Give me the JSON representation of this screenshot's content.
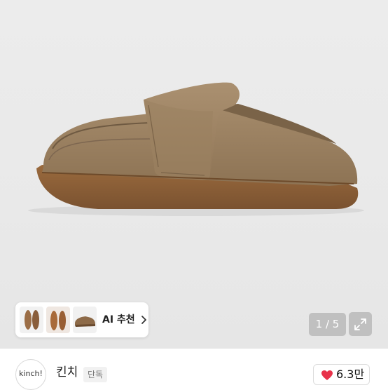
{
  "gallery": {
    "counter": "1 / 5",
    "expand_icon": "expand-icon"
  },
  "ai_recommend": {
    "label": "AI 추천",
    "thumbnails": [
      "loafer-pair-top",
      "loafer-pair-top-2",
      "loafer-side"
    ],
    "chevron_icon": "chevron-right-icon"
  },
  "shop": {
    "logo_text": "kinch!",
    "name": "킨치",
    "badge": "단독",
    "like_count": "6.3만",
    "heart_color": "#e8324a"
  }
}
